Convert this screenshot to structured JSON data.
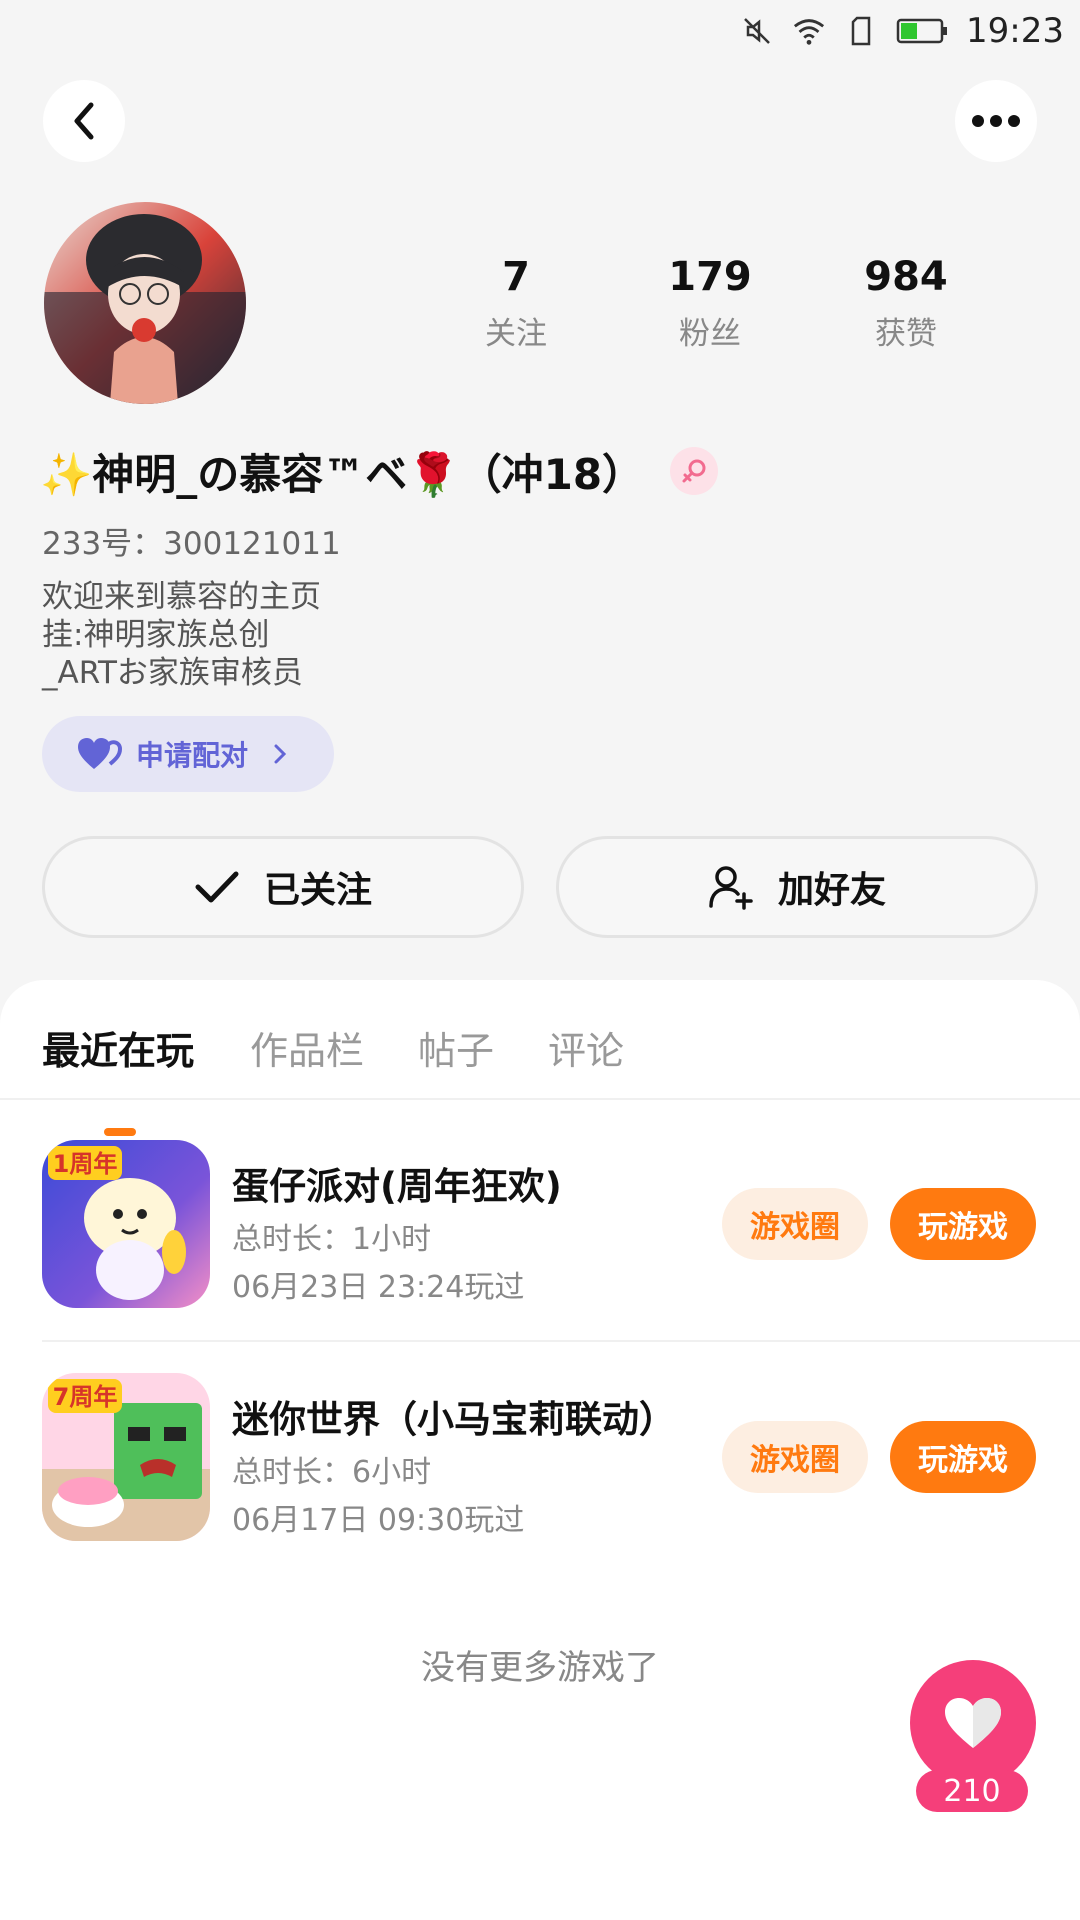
{
  "status_bar": {
    "time": "19:23",
    "icons": [
      "mute-icon",
      "wifi-icon",
      "sim-icon",
      "battery-icon"
    ],
    "battery_color": "#2fc62f"
  },
  "header": {
    "back_icon": "chevron-left-icon",
    "more_icon": "more-dots-icon"
  },
  "profile": {
    "stats": [
      {
        "value": "7",
        "label": "关注"
      },
      {
        "value": "179",
        "label": "粉丝"
      },
      {
        "value": "984",
        "label": "获赞"
      }
    ],
    "username": "✨神明_の慕容™ベ🌹（冲18）",
    "gender_icon": "female-icon",
    "account_id": "233号：300121011",
    "bio_lines": [
      "欢迎来到慕容的主页",
      "挂:神明家族总创",
      "_ARTお家族审核员"
    ],
    "pair_button": {
      "label": "申请配对",
      "icon": "heart-pair-icon"
    }
  },
  "actions": {
    "follow": {
      "label": "已关注",
      "icon": "check-icon"
    },
    "add_friend": {
      "label": "加好友",
      "icon": "add-user-icon"
    }
  },
  "tabs": [
    {
      "label": "最近在玩",
      "active": true
    },
    {
      "label": "作品栏",
      "active": false
    },
    {
      "label": "帖子",
      "active": false
    },
    {
      "label": "评论",
      "active": false
    }
  ],
  "games": [
    {
      "title": "蛋仔派对(周年狂欢)",
      "duration": "总时长：1小时",
      "last_played": "06月23日 23:24玩过",
      "icon_badge": "1周年",
      "circle_label": "游戏圈",
      "play_label": "玩游戏"
    },
    {
      "title": "迷你世界（小马宝莉联动）",
      "duration": "总时长：6小时",
      "last_played": "06月17日 09:30玩过",
      "icon_badge": "7周年",
      "circle_label": "游戏圈",
      "play_label": "玩游戏"
    }
  ],
  "footer_text": "没有更多游戏了",
  "like_button": {
    "count": "210",
    "icon": "heart-icon"
  },
  "colors": {
    "accent": "#ff7a10",
    "pair_purple": "#6264d6",
    "like_pink": "#f53f7a"
  }
}
